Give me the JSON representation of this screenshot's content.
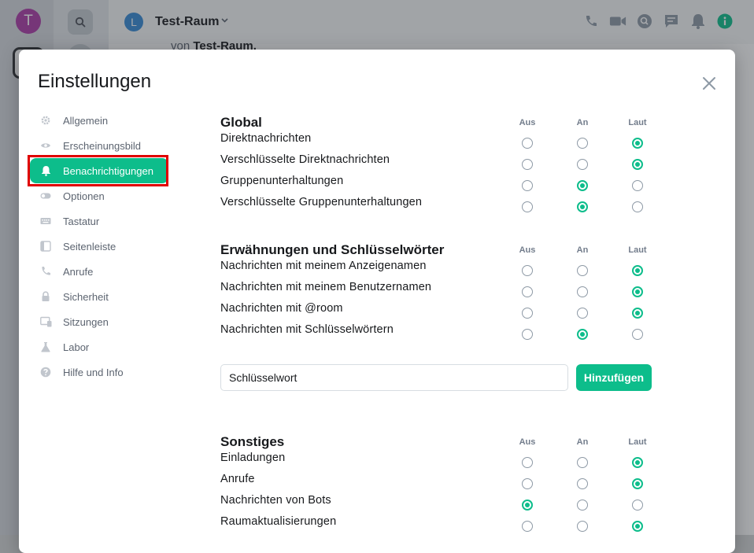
{
  "app": {
    "user_initial": "T",
    "room_initial": "L",
    "room_name": "Test-Raum",
    "timeline_prefix": "von",
    "timeline_room": "Test-Raum."
  },
  "dialog": {
    "title": "Einstellungen",
    "nav": [
      {
        "label": "Allgemein",
        "icon": "gear-icon"
      },
      {
        "label": "Erscheinungsbild",
        "icon": "eye-icon"
      },
      {
        "label": "Benachrichtigungen",
        "icon": "bell-icon",
        "active": true
      },
      {
        "label": "Optionen",
        "icon": "toggle-icon"
      },
      {
        "label": "Tastatur",
        "icon": "keyboard-icon"
      },
      {
        "label": "Seitenleiste",
        "icon": "sidebar-icon"
      },
      {
        "label": "Anrufe",
        "icon": "phone-icon"
      },
      {
        "label": "Sicherheit",
        "icon": "lock-icon"
      },
      {
        "label": "Sitzungen",
        "icon": "devices-icon"
      },
      {
        "label": "Labor",
        "icon": "flask-icon"
      },
      {
        "label": "Hilfe und Info",
        "icon": "help-icon"
      }
    ],
    "columns": [
      "Aus",
      "An",
      "Laut"
    ],
    "sections": [
      {
        "title": "Global",
        "rows": [
          {
            "label": "Direktnachrichten",
            "selected": "Laut"
          },
          {
            "label": "Verschlüsselte Direktnachrichten",
            "selected": "Laut"
          },
          {
            "label": "Gruppenunterhaltungen",
            "selected": "An"
          },
          {
            "label": "Verschlüsselte Gruppenunterhaltungen",
            "selected": "An"
          }
        ]
      },
      {
        "title": "Erwähnungen und Schlüsselwörter",
        "rows": [
          {
            "label": "Nachrichten mit meinem Anzeigenamen",
            "selected": "Laut"
          },
          {
            "label": "Nachrichten mit meinem Benutzernamen",
            "selected": "Laut"
          },
          {
            "label": "Nachrichten mit @room",
            "selected": "Laut"
          },
          {
            "label": "Nachrichten mit Schlüsselwörtern",
            "selected": "An"
          }
        ]
      },
      {
        "title": "Sonstiges",
        "rows": [
          {
            "label": "Einladungen",
            "selected": "Laut"
          },
          {
            "label": "Anrufe",
            "selected": "Laut"
          },
          {
            "label": "Nachrichten von Bots",
            "selected": "Aus"
          },
          {
            "label": "Raumaktualisierungen",
            "selected": "Laut"
          }
        ]
      }
    ],
    "keyword": {
      "placeholder": "Schlüsselwort",
      "add_label": "Hinzufügen"
    }
  },
  "colors": {
    "accent": "#0dbd8b",
    "highlight": "#e00000"
  }
}
